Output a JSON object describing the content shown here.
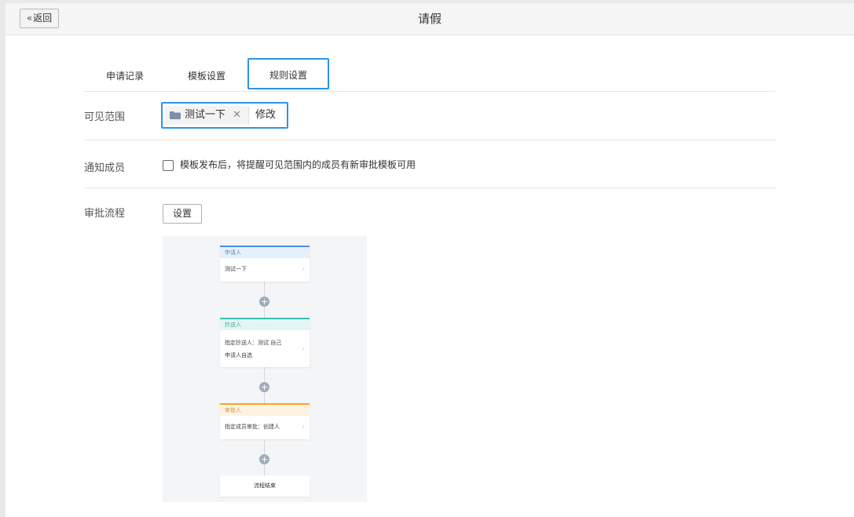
{
  "header": {
    "back_label": "返回",
    "title": "请假"
  },
  "tabs": [
    {
      "label": "申请记录"
    },
    {
      "label": "模板设置"
    },
    {
      "label": "规则设置",
      "active": true
    }
  ],
  "visible_scope": {
    "label": "可见范围",
    "tag": "测试一下",
    "modify_label": "修改"
  },
  "notify": {
    "label": "通知成员",
    "checkbox_text": "模板发布后，将提醒可见范围内的成员有新审批模板可用",
    "checked": false
  },
  "approval_flow": {
    "label": "审批流程",
    "set_button": "设置",
    "nodes": [
      {
        "title": "申请人",
        "lines": [
          "测试一下"
        ],
        "color": "#4a8fe0",
        "bg": "#e6f0fc",
        "title_color": "#5b8fd0"
      },
      {
        "title": "抄送人",
        "lines": [
          "指定抄送人：测试 自己",
          "申请人自选"
        ],
        "color": "#3bbfb0",
        "bg": "#e4f6f4",
        "title_color": "#4aa89d"
      },
      {
        "title": "审批人",
        "lines": [
          "指定成员审批：创建人"
        ],
        "color": "#f5a623",
        "bg": "#fdf3e3",
        "title_color": "#d49a3a"
      }
    ],
    "end_label": "流程结束"
  }
}
